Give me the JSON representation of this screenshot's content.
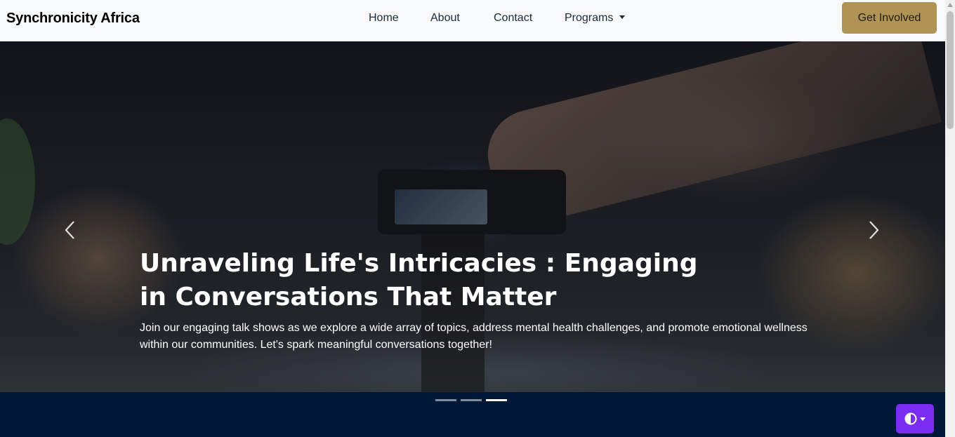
{
  "nav": {
    "brand": "Synchronicity Africa",
    "links": [
      "Home",
      "About",
      "Contact",
      "Programs"
    ],
    "cta": "Get Involved"
  },
  "hero": {
    "title": "Unraveling Life's Intricacies : Engaging in Conversations That Matter",
    "text": "Join our engaging talk shows as we explore a wide array of topics, address mental health challenges, and promote emotional wellness within our communities. Let's spark meaningful conversations together!",
    "slide_count": 3,
    "active_slide": 3
  },
  "icons": {
    "prev": "chevron-left-icon",
    "next": "chevron-right-icon",
    "theme": "contrast-icon",
    "dropdown": "caret-down-icon"
  },
  "colors": {
    "navbar_bg": "#f8f9fa",
    "cta_bg": "#b09455",
    "page_bg": "#001838",
    "theme_button": "#7a2cf2"
  }
}
